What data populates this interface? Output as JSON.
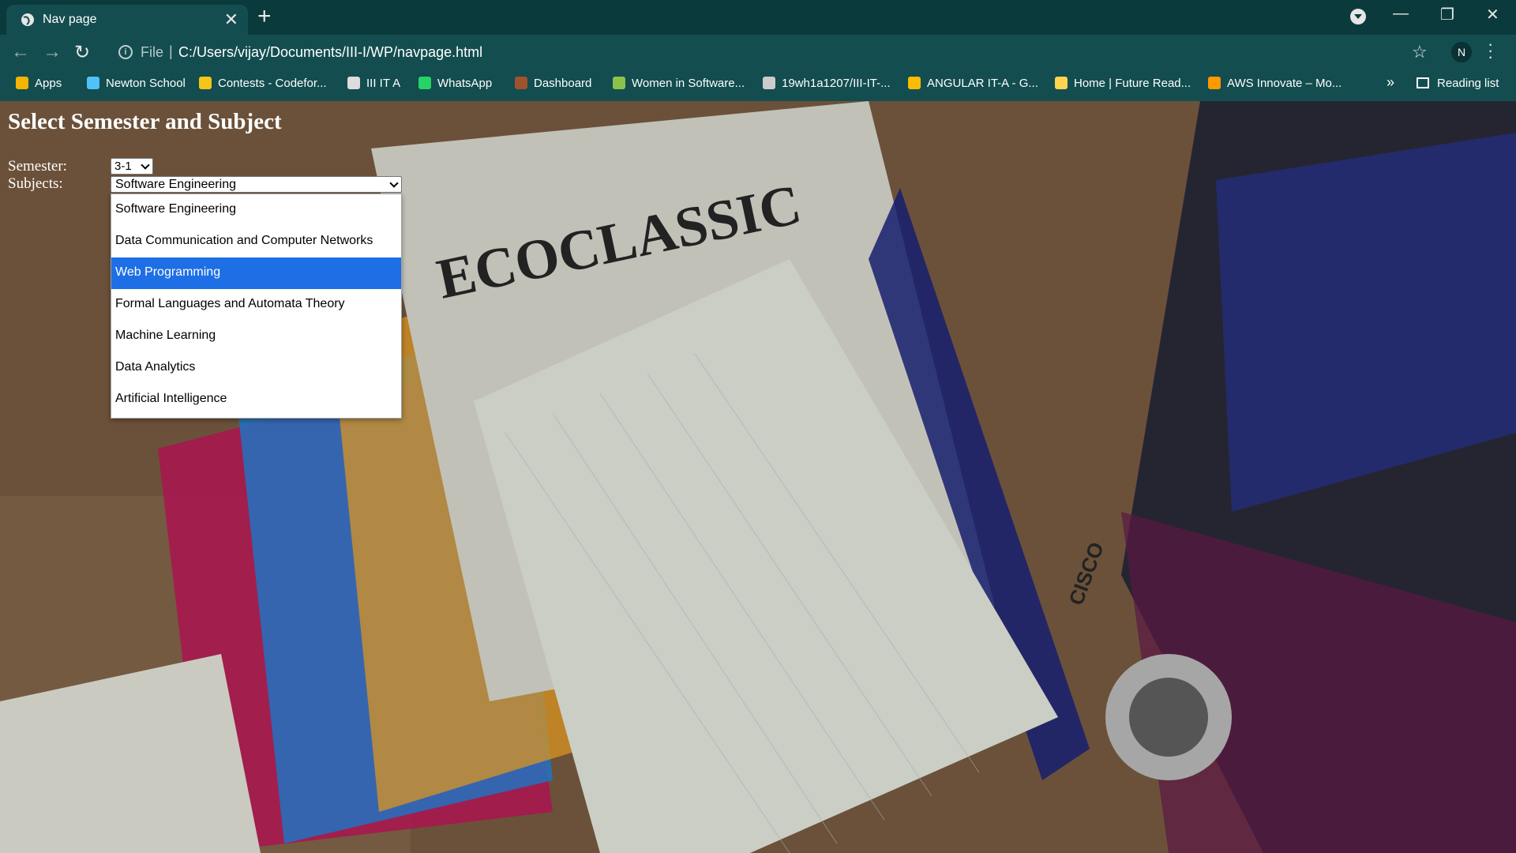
{
  "browser": {
    "tab_title": "Nav page",
    "tab_close": "✕",
    "new_tab": "+",
    "address": {
      "scheme_label": "File",
      "separator": "|",
      "url": "C:/Users/vijay/Documents/III-I/WP/navpage.html"
    },
    "profile_initial": "N",
    "window_controls": {
      "minimize": "—",
      "restore": "❐",
      "close": "✕"
    }
  },
  "bookmarks": [
    {
      "label": "Apps",
      "icon": "apps-grid-icon",
      "color": "#f4b400"
    },
    {
      "label": "Newton School",
      "icon": "newton-school-icon",
      "color": "#4fc3f7"
    },
    {
      "label": "Contests - Codefor...",
      "icon": "codeforces-icon",
      "color": "#f5c518"
    },
    {
      "label": "III IT A",
      "icon": "classroom-icon",
      "color": "#dddddd"
    },
    {
      "label": "WhatsApp",
      "icon": "whatsapp-icon",
      "color": "#25d366"
    },
    {
      "label": "Dashboard",
      "icon": "dashboard-icon",
      "color": "#a0522d"
    },
    {
      "label": "Women in Software...",
      "icon": "women-in-software-icon",
      "color": "#8bc34a"
    },
    {
      "label": "19wh1a1207/III-IT-...",
      "icon": "github-icon",
      "color": "#cccccc"
    },
    {
      "label": "ANGULAR IT-A - G...",
      "icon": "google-drive-icon",
      "color": "#fbbc04"
    },
    {
      "label": "Home | Future Read...",
      "icon": "future-ready-icon",
      "color": "#ffd54f"
    },
    {
      "label": "AWS Innovate – Mo...",
      "icon": "aws-icon",
      "color": "#ff9900"
    }
  ],
  "bookmarks_overflow": "»",
  "reading_list": "Reading list",
  "page": {
    "heading": "Select Semester and Subject",
    "semester_label": "Semester:",
    "semester_value": "3-1",
    "subjects_label": "Subjects:",
    "subjects_value": "Software Engineering",
    "subject_options": [
      "Software Engineering",
      "Data Communication and Computer Networks",
      "Web Programming",
      "Formal Languages and Automata Theory",
      "Machine Learning",
      "Data Analytics",
      "Artificial Intelligence"
    ],
    "highlighted_option_index": 2,
    "highlight_color": "#1e6fe6",
    "background_print_text": [
      "ECOCLASSIC",
      "CISCO"
    ]
  }
}
